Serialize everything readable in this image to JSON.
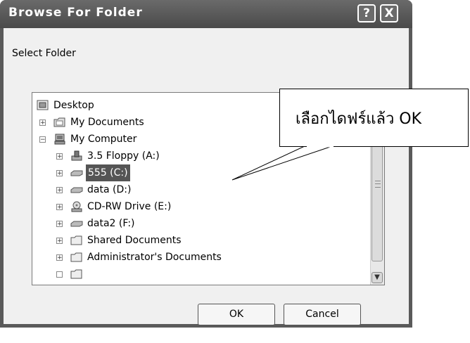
{
  "dialog": {
    "title": "Browse For Folder",
    "help_label": "?",
    "close_label": "X",
    "prompt": "Select Folder"
  },
  "tree": {
    "items": [
      {
        "label": "Desktop",
        "icon": "desktop-icon",
        "level": 0
      },
      {
        "label": "My Documents",
        "icon": "documents-folder-icon",
        "level": 1,
        "expander": "+"
      },
      {
        "label": "My Computer",
        "icon": "computer-icon",
        "level": 1,
        "expander": "−"
      },
      {
        "label": "3.5 Floppy (A:)",
        "icon": "floppy-drive-icon",
        "level": 2,
        "expander": "+"
      },
      {
        "label": "555 (C:)",
        "icon": "hard-drive-icon",
        "level": 2,
        "expander": "+",
        "selected": true
      },
      {
        "label": "data (D:)",
        "icon": "hard-drive-icon",
        "level": 2,
        "expander": "+"
      },
      {
        "label": "CD-RW Drive (E:)",
        "icon": "cd-drive-icon",
        "level": 2,
        "expander": "+"
      },
      {
        "label": "data2 (F:)",
        "icon": "hard-drive-icon",
        "level": 2,
        "expander": "+"
      },
      {
        "label": "Shared Documents",
        "icon": "folder-icon",
        "level": 2,
        "expander": "+"
      },
      {
        "label": "Administrator's Documents",
        "icon": "folder-icon",
        "level": 2,
        "expander": "+"
      }
    ]
  },
  "buttons": {
    "ok": "OK",
    "cancel": "Cancel"
  },
  "callout": {
    "text": "เลือกไดฟร์แล้ว OK"
  },
  "colors": {
    "titlebar": "#5a5a5a",
    "selection": "#555555"
  }
}
